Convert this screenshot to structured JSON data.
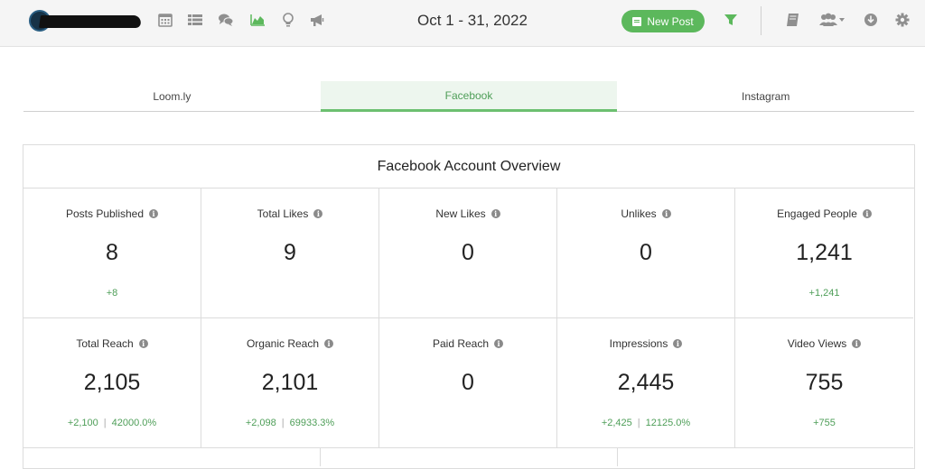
{
  "header": {
    "date_range": "Oct 1 - 31, 2022",
    "new_post_label": "New Post"
  },
  "colors": {
    "accent_green": "#5cb85c",
    "nav_icon_gray": "#8f8f8f",
    "nav_icon_active_green": "#5cb85c"
  },
  "nav_icons": [
    "calendar-icon",
    "list-icon",
    "comments-icon",
    "analytics-icon",
    "idea-icon",
    "megaphone-icon"
  ],
  "right_icons": [
    "book-icon",
    "team-icon",
    "download-icon",
    "settings-icon"
  ],
  "tabs": [
    {
      "label": "Loom.ly"
    },
    {
      "label": "Facebook"
    },
    {
      "label": "Instagram"
    }
  ],
  "overview": {
    "title": "Facebook Account Overview",
    "metrics": [
      {
        "label": "Posts Published",
        "value": "8",
        "change": "+8",
        "pct": ""
      },
      {
        "label": "Total Likes",
        "value": "9",
        "change": "",
        "pct": ""
      },
      {
        "label": "New Likes",
        "value": "0",
        "change": "",
        "pct": ""
      },
      {
        "label": "Unlikes",
        "value": "0",
        "change": "",
        "pct": ""
      },
      {
        "label": "Engaged People",
        "value": "1,241",
        "change": "+1,241",
        "pct": ""
      },
      {
        "label": "Total Reach",
        "value": "2,105",
        "change": "+2,100",
        "pct": "42000.0%"
      },
      {
        "label": "Organic Reach",
        "value": "2,101",
        "change": "+2,098",
        "pct": "69933.3%"
      },
      {
        "label": "Paid Reach",
        "value": "0",
        "change": "",
        "pct": ""
      },
      {
        "label": "Impressions",
        "value": "2,445",
        "change": "+2,425",
        "pct": "12125.0%"
      },
      {
        "label": "Video Views",
        "value": "755",
        "change": "+755",
        "pct": ""
      }
    ]
  }
}
